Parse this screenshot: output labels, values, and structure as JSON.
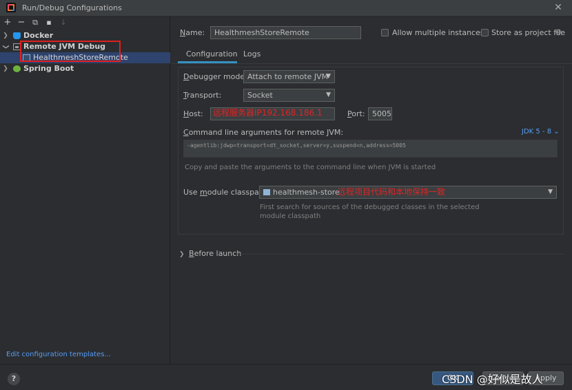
{
  "window": {
    "title": "Run/Debug Configurations"
  },
  "toolbar": {
    "add": "+",
    "remove": "−",
    "copy": "⧉",
    "move": "▪",
    "sort": "↓"
  },
  "tree": {
    "docker": "Docker",
    "remote_jvm": "Remote JVM Debug",
    "remote_child": "HealthmeshStoreRemote",
    "spring_boot": "Spring Boot"
  },
  "edit_templates": "Edit configuration templates...",
  "form": {
    "name_label": "Name:",
    "name_value": "HealthmeshStoreRemote",
    "allow_multiple": "Allow multiple instances",
    "store_as_file": "Store as project file"
  },
  "tabs": [
    "Configuration",
    "Logs"
  ],
  "config": {
    "debugger_mode_label": "Debugger mode:",
    "debugger_mode_value": "Attach to remote JVM",
    "transport_label": "Transport:",
    "transport_value": "Socket",
    "host_label": "Host:",
    "host_value": "192.168.186.1",
    "host_annotation": "远程服务器IP",
    "port_label": "Port:",
    "port_value": "5005",
    "cmd_label": "Command line arguments for remote JVM:",
    "jdk_selector": "JDK 5 - 8",
    "cmd_value": "-agentlib:jdwp=transport=dt_socket,server=y,suspend=n,address=5005",
    "cmd_hint": "Copy and paste the arguments to the command line when JVM is started",
    "classpath_label": "Use module classpath:",
    "classpath_value": "healthmesh-store",
    "classpath_annotation": "远程项目代码和本地保持一致",
    "classpath_hint_1": "First search for sources of the debugged classes in the selected",
    "classpath_hint_2": "module classpath"
  },
  "before_launch": "Before launch",
  "buttons": {
    "help": "?",
    "ok": "OK",
    "cancel": "Cancel",
    "apply": "Apply"
  },
  "watermark": "CSDN @好似是故人",
  "colors": {
    "accent": "#3592c4",
    "selection": "#2e436e",
    "annotation": "#e02424",
    "link": "#589df6"
  }
}
